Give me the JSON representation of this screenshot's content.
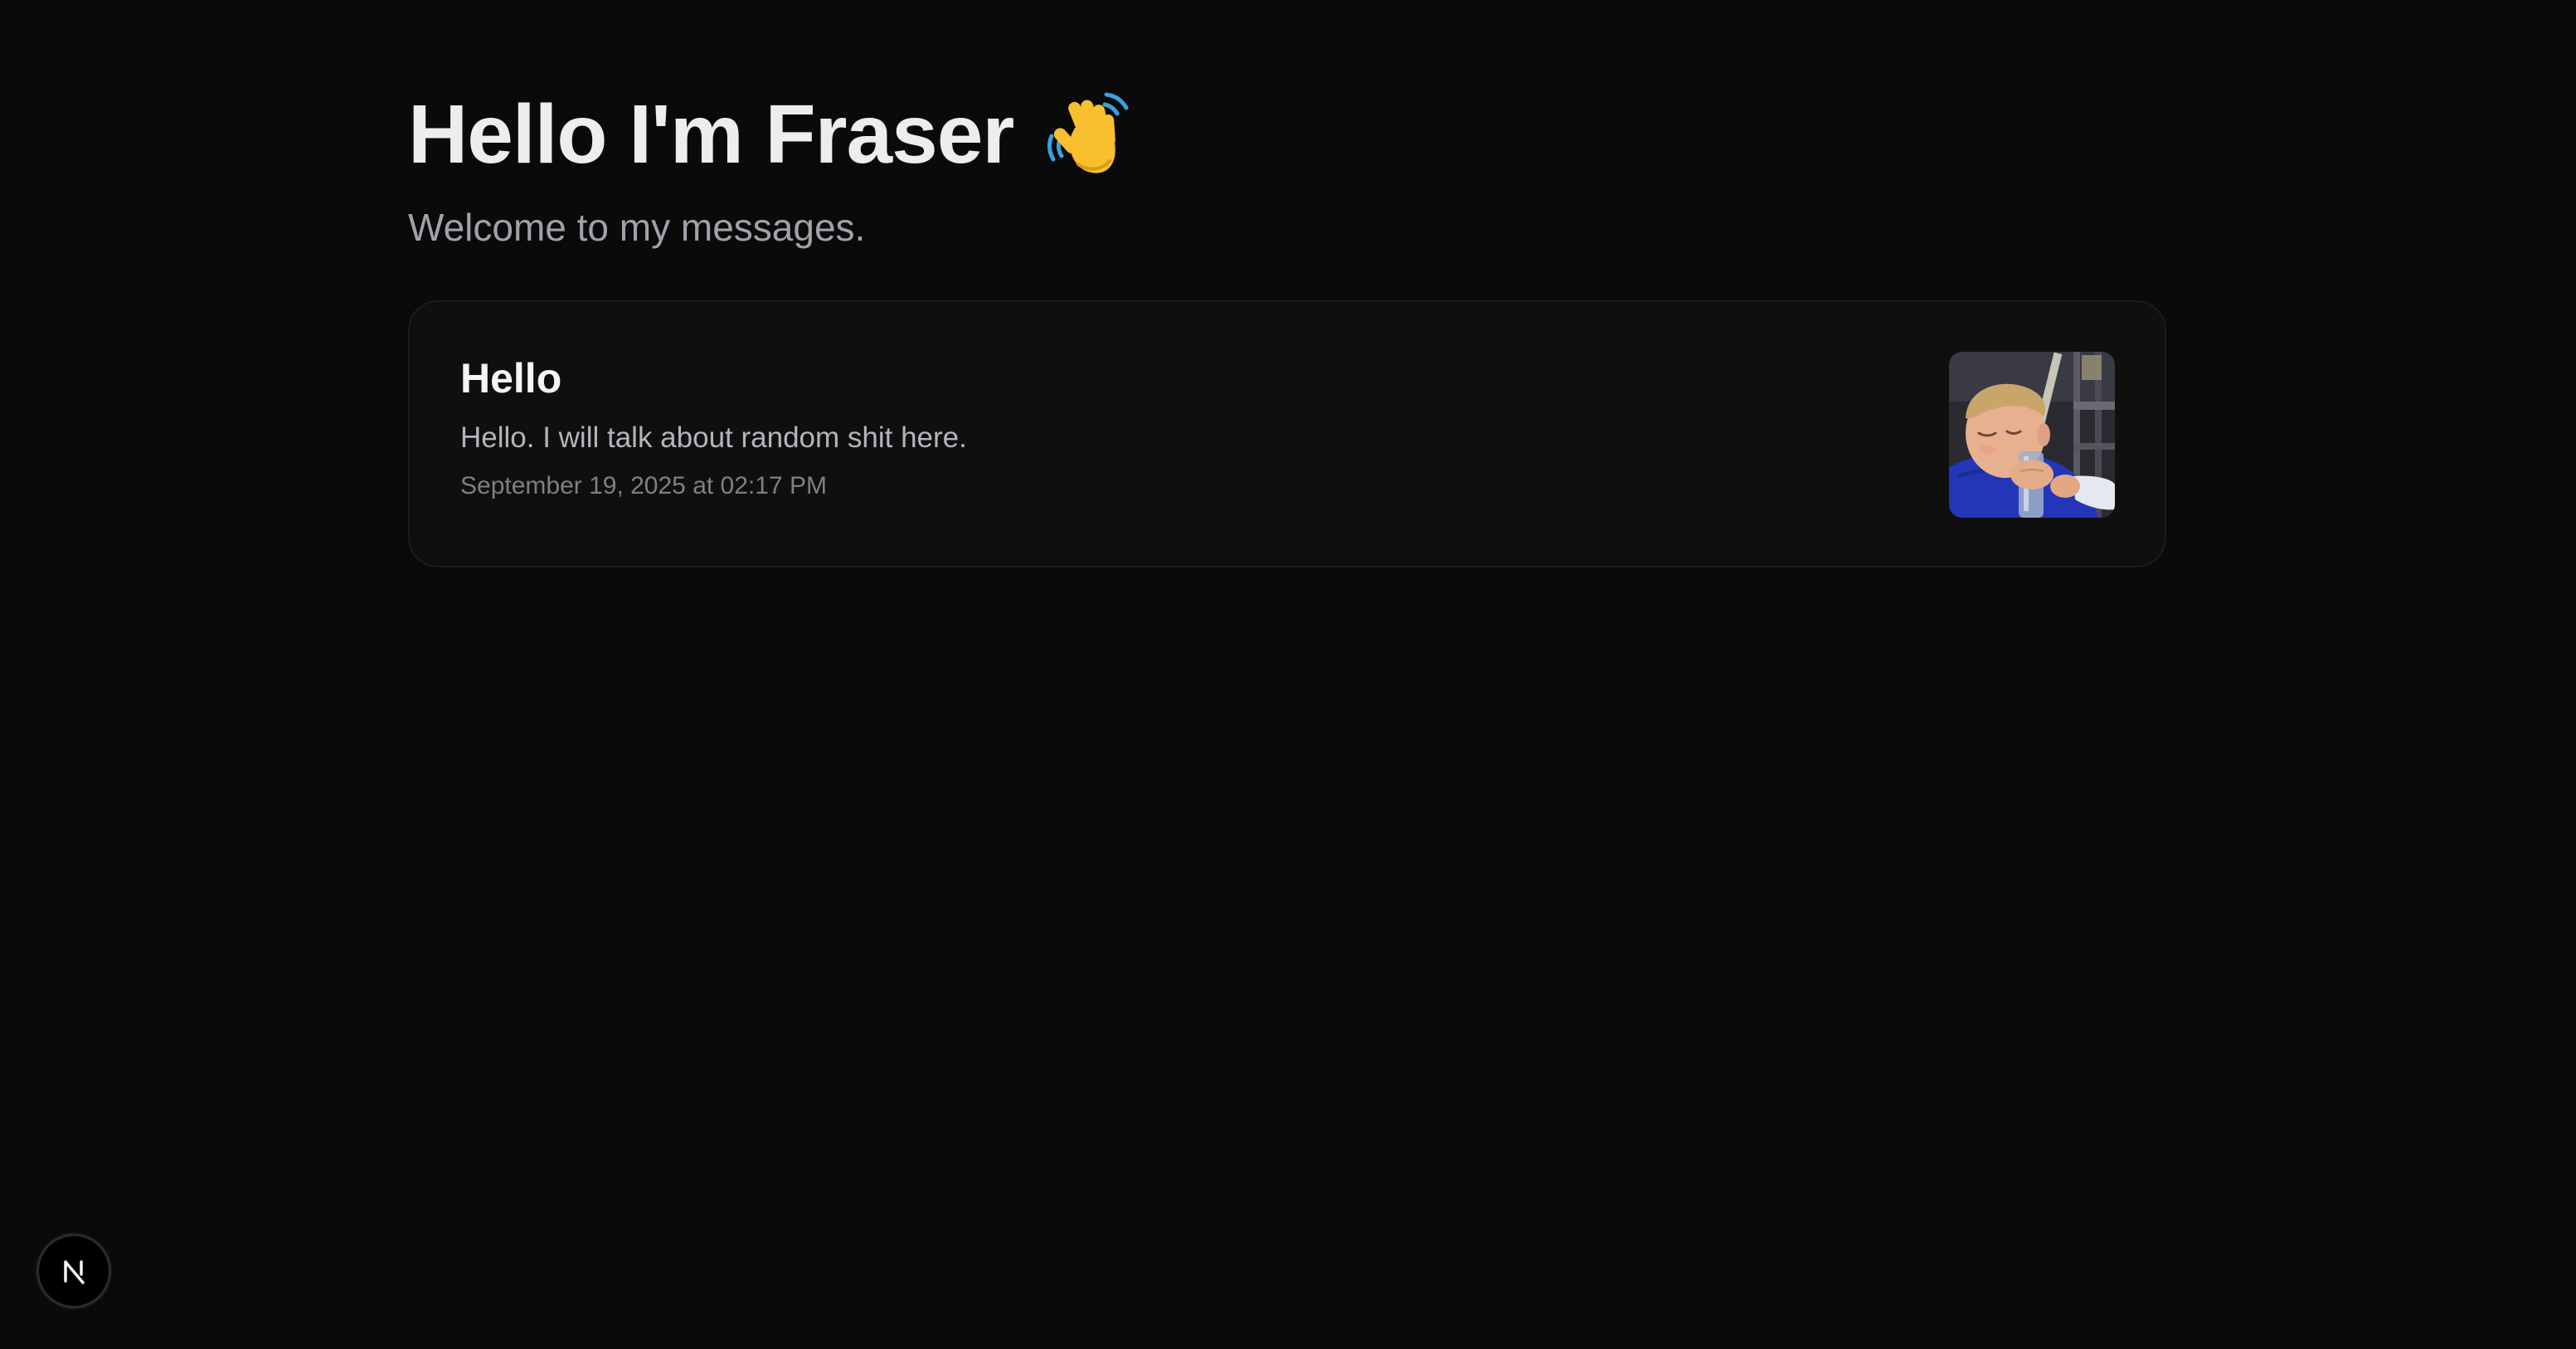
{
  "header": {
    "title": "Hello I'm Fraser",
    "title_icon": "waving-hand-icon",
    "subtitle": "Welcome to my messages."
  },
  "messages": [
    {
      "title": "Hello",
      "body": "Hello. I will talk about random shit here.",
      "date": "September 19, 2025 at 02:17 PM",
      "thumbnail": "child-photo"
    }
  ],
  "dev_badge": {
    "icon": "nextjs-logo-icon",
    "letter": "N"
  },
  "colors": {
    "background": "#0a0a0a",
    "card_background": "#0f0f0f",
    "card_border": "#1c1c1c",
    "title": "#ededed",
    "muted_text": "#a1a1aa"
  }
}
